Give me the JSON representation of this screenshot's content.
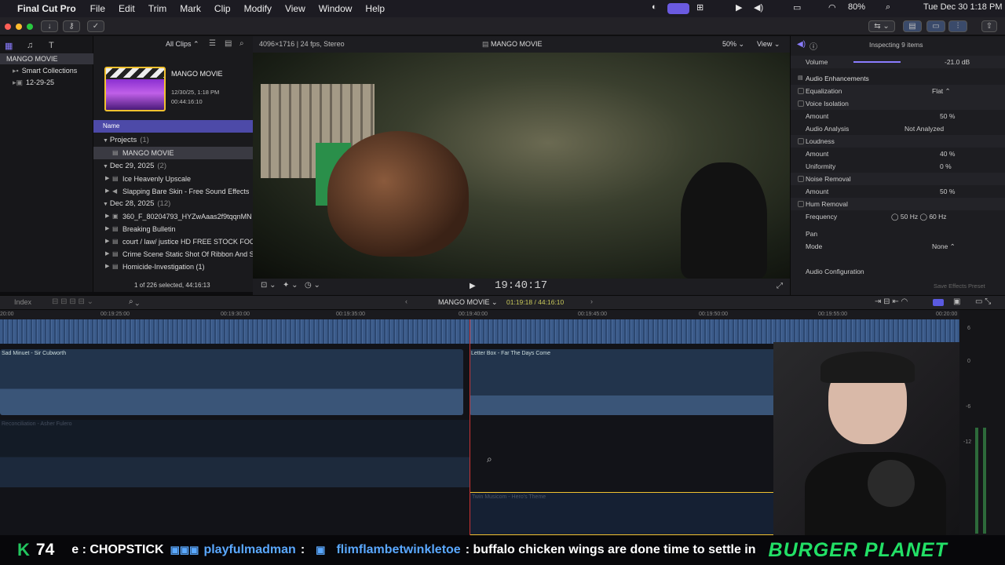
{
  "menubar": {
    "app_name": "Final Cut Pro",
    "items": [
      "File",
      "Edit",
      "Trim",
      "Mark",
      "Clip",
      "Modify",
      "View",
      "Window",
      "Help"
    ],
    "battery": "80%",
    "datetime": "Tue Dec 30  1:18 PM"
  },
  "browser": {
    "library": "MANGO MOVIE",
    "sidebar_items": [
      "Smart Collections",
      "12-29-25"
    ],
    "filter": "All Clips",
    "project_card": {
      "title": "MANGO MOVIE",
      "date": "12/30/25, 1:18 PM",
      "duration": "00:44:16:10"
    },
    "column_header": "Name",
    "groups": [
      {
        "label": "Projects",
        "count": "(1)",
        "rows": [
          "MANGO MOVIE"
        ]
      },
      {
        "label": "Dec 29, 2025",
        "count": "(2)",
        "rows": [
          "Ice Heavenly Upscale",
          "Slapping Bare Skin - Free Sound Effects"
        ]
      },
      {
        "label": "Dec 28, 2025",
        "count": "(12)",
        "rows": [
          "360_F_80204793_HYZwAaas2f9tqqnMN",
          "Breaking Bulletin",
          "court / law/ justice HD FREE STOCK FOO",
          "Crime Scene Static Shot Of Ribbon And S",
          "Homicide-Investigation (1)"
        ]
      }
    ],
    "status": "1 of 226 selected, 44:16:13"
  },
  "viewer": {
    "format": "4096×1716 | 24 fps, Stereo",
    "title": "MANGO MOVIE",
    "zoom": "50%",
    "view_label": "View",
    "timecode": "19:40:17"
  },
  "inspector": {
    "header": "Inspecting 9 items",
    "volume_label": "Volume",
    "volume_value": "-21.0  dB",
    "section": "Audio Enhancements",
    "rows": [
      {
        "label": "Equalization",
        "value": "Flat ⌃",
        "check": true
      },
      {
        "label": "Voice Isolation",
        "value": "",
        "check": true
      },
      {
        "label": "Amount",
        "value": "50  %",
        "check": false
      },
      {
        "label": "Audio Analysis",
        "value": "Not Analyzed",
        "check": false
      },
      {
        "label": "Loudness",
        "value": "",
        "check": true
      },
      {
        "label": "Amount",
        "value": "40  %",
        "check": false
      },
      {
        "label": "Uniformity",
        "value": "0  %",
        "check": false
      },
      {
        "label": "Noise Removal",
        "value": "",
        "check": true
      },
      {
        "label": "Amount",
        "value": "50  %",
        "check": false
      },
      {
        "label": "Hum Removal",
        "value": "",
        "check": true
      },
      {
        "label": "Frequency",
        "value": "◯ 50 Hz    ◯ 60 Hz",
        "check": false
      },
      {
        "label": "Pan",
        "value": "",
        "check": false
      },
      {
        "label": "Mode",
        "value": "None ⌃",
        "check": false
      }
    ],
    "audio_config": "Audio Configuration",
    "save_preset": "Save Effects Preset"
  },
  "timeline": {
    "index_label": "Index",
    "project": "MANGO MOVIE",
    "position": "01:19:18 / 44:16:10",
    "ruler": [
      "00:19:25:00",
      "00:19:30:00",
      "00:19:35:00",
      "00:19:40:00",
      "00:19:45:00",
      "00:19:50:00",
      "00:19:55:00",
      "00:20:00"
    ],
    "clips": [
      "Sad Minuet - Sir Cubworth",
      "Letter Box - Far The Days Come",
      "Reconciliation - Asher Fulero",
      "Twin Musicom - Hero's Theme"
    ],
    "meter_labels": [
      "6",
      "0",
      "-6",
      "-12"
    ]
  },
  "ticker": {
    "count_badge": "K",
    "count": "74",
    "segment1": "e : CHOPSTICK",
    "user": "playfulmadman",
    "user_sep": ":",
    "user2": "flimflambetwinkletoe",
    "message": ": buffalo chicken wings are done time to settle in",
    "sponsor": "BURGER PLANET"
  }
}
